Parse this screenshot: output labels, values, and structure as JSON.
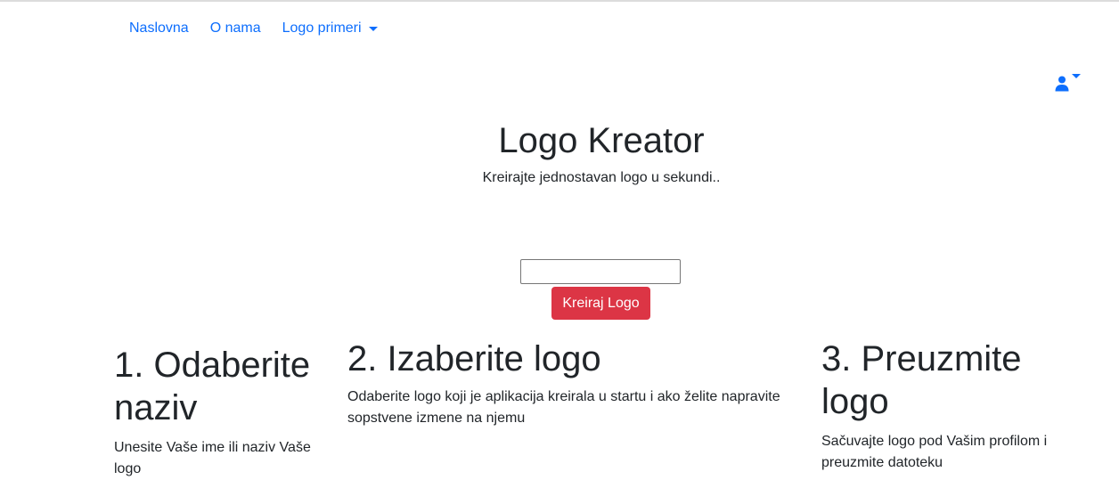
{
  "nav": {
    "items": [
      {
        "label": "Naslovna"
      },
      {
        "label": "O nama"
      },
      {
        "label": "Logo primeri"
      }
    ]
  },
  "user_menu": {
    "icon": "user-icon"
  },
  "hero": {
    "title": "Logo Kreator",
    "subtitle": "Kreirajte jednostavan logo u sekundi.."
  },
  "form": {
    "input_value": "",
    "button_label": "Kreiraj Logo"
  },
  "steps": [
    {
      "title": "1. Odaberite naziv",
      "text": "Unesite Vaše ime ili naziv Vaše logo"
    },
    {
      "title": "2. Izaberite logo",
      "text": "Odaberite logo koji je aplikacija kreirala u startu i ako želite napravite sopstvene izmene na njemu"
    },
    {
      "title": "3. Preuzmite logo",
      "text": "Sačuvajte logo pod Vašim profilom i preuzmite datoteku"
    }
  ],
  "colors": {
    "link": "#0d6efd",
    "button": "#dc3545"
  }
}
